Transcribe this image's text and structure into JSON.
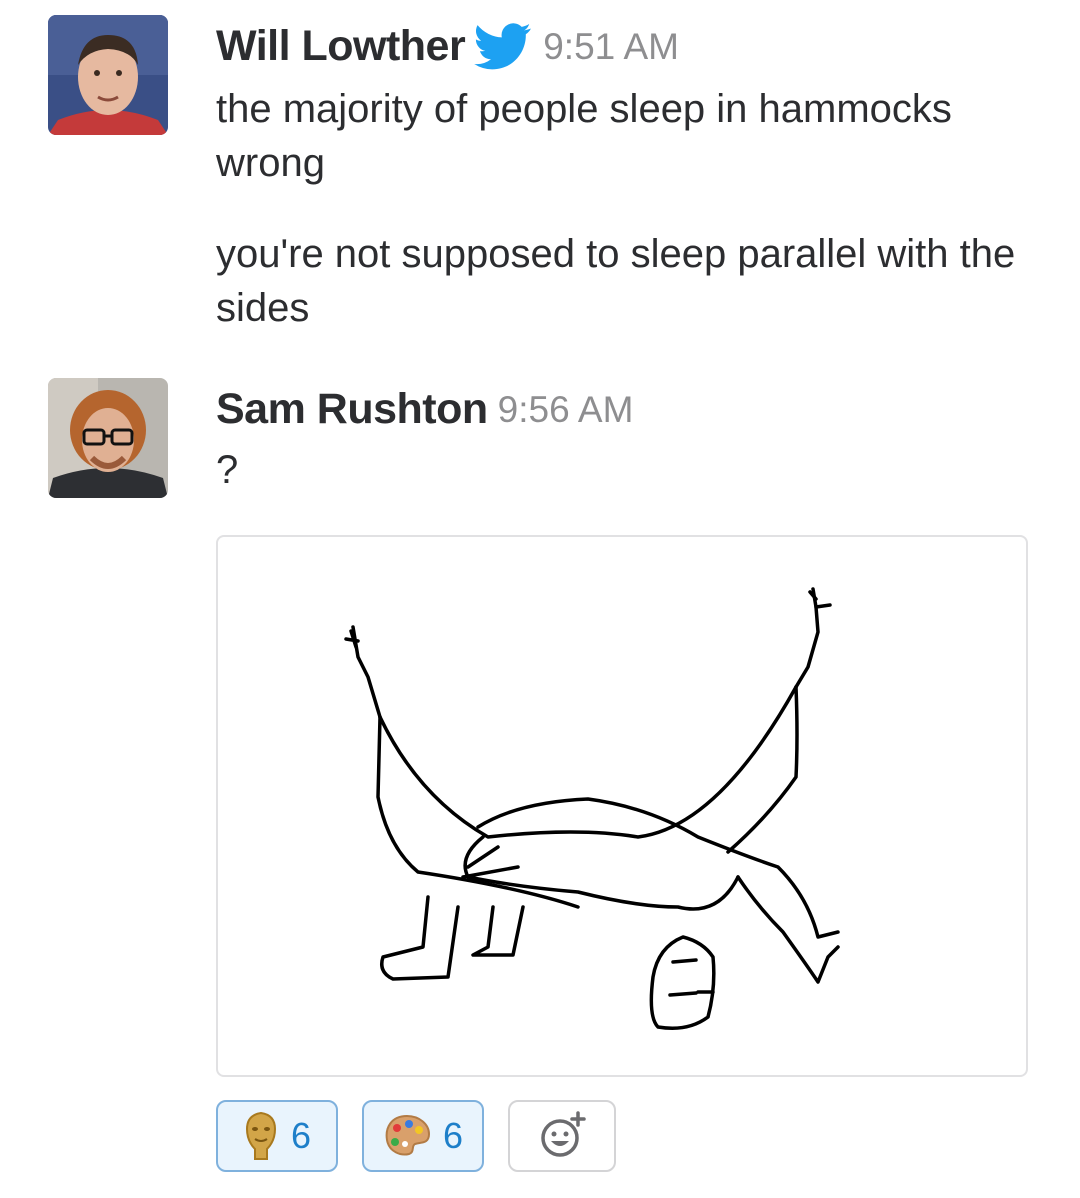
{
  "messages": [
    {
      "author": "Will Lowther",
      "time": "9:51 AM",
      "verified_icon": "twitter-bird-icon",
      "paragraphs": [
        "the majority of people sleep in hammocks wrong",
        "you're not supposed to sleep parallel with the sides"
      ]
    },
    {
      "author": "Sam Rushton",
      "time": "9:56 AM",
      "text": "?"
    }
  ],
  "reactions": [
    {
      "emoji": "bafta-mask-icon",
      "count": "6",
      "selected": true
    },
    {
      "emoji": "artist-palette-icon",
      "count": "6",
      "selected": true
    }
  ],
  "add_reaction_icon": "add-reaction-icon",
  "colors": {
    "link_blue": "#1e7fc9",
    "reaction_bg": "#e9f4fd",
    "reaction_border": "#7fb1dd",
    "twitter_blue": "#1da1f2"
  }
}
